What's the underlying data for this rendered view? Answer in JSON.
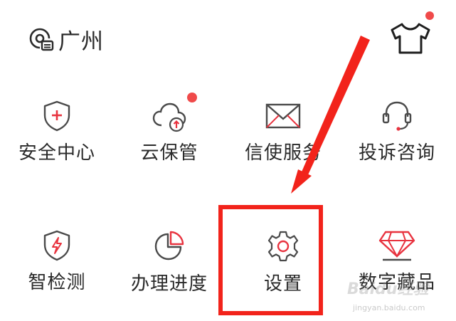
{
  "header": {
    "location_icon": "location-card-icon",
    "location_label": "广州",
    "wardrobe_icon": "tshirt-icon"
  },
  "services": [
    {
      "label": "安全中心",
      "icon": "shield-plus-icon",
      "badge": false
    },
    {
      "label": "云保管",
      "icon": "cloud-upload-icon",
      "badge": true
    },
    {
      "label": "信使服务",
      "icon": "envelope-icon",
      "badge": false
    },
    {
      "label": "投诉咨询",
      "icon": "headset-icon",
      "badge": false
    },
    {
      "label": "智检测",
      "icon": "shield-bolt-icon",
      "badge": false
    },
    {
      "label": "办理进度",
      "icon": "pie-progress-icon",
      "badge": false
    },
    {
      "label": "设置",
      "icon": "gear-icon",
      "badge": false
    },
    {
      "label": "数字藏品",
      "icon": "diamond-icon",
      "badge": false
    }
  ],
  "watermark": {
    "main": "Baidu经验",
    "sub": "jingyan.baidu.com"
  },
  "colors": {
    "accent_red": "#e8333f",
    "badge_red": "#f04a4a",
    "icon_gray": "#4a4a4a",
    "annotation_red": "#f2231b"
  }
}
